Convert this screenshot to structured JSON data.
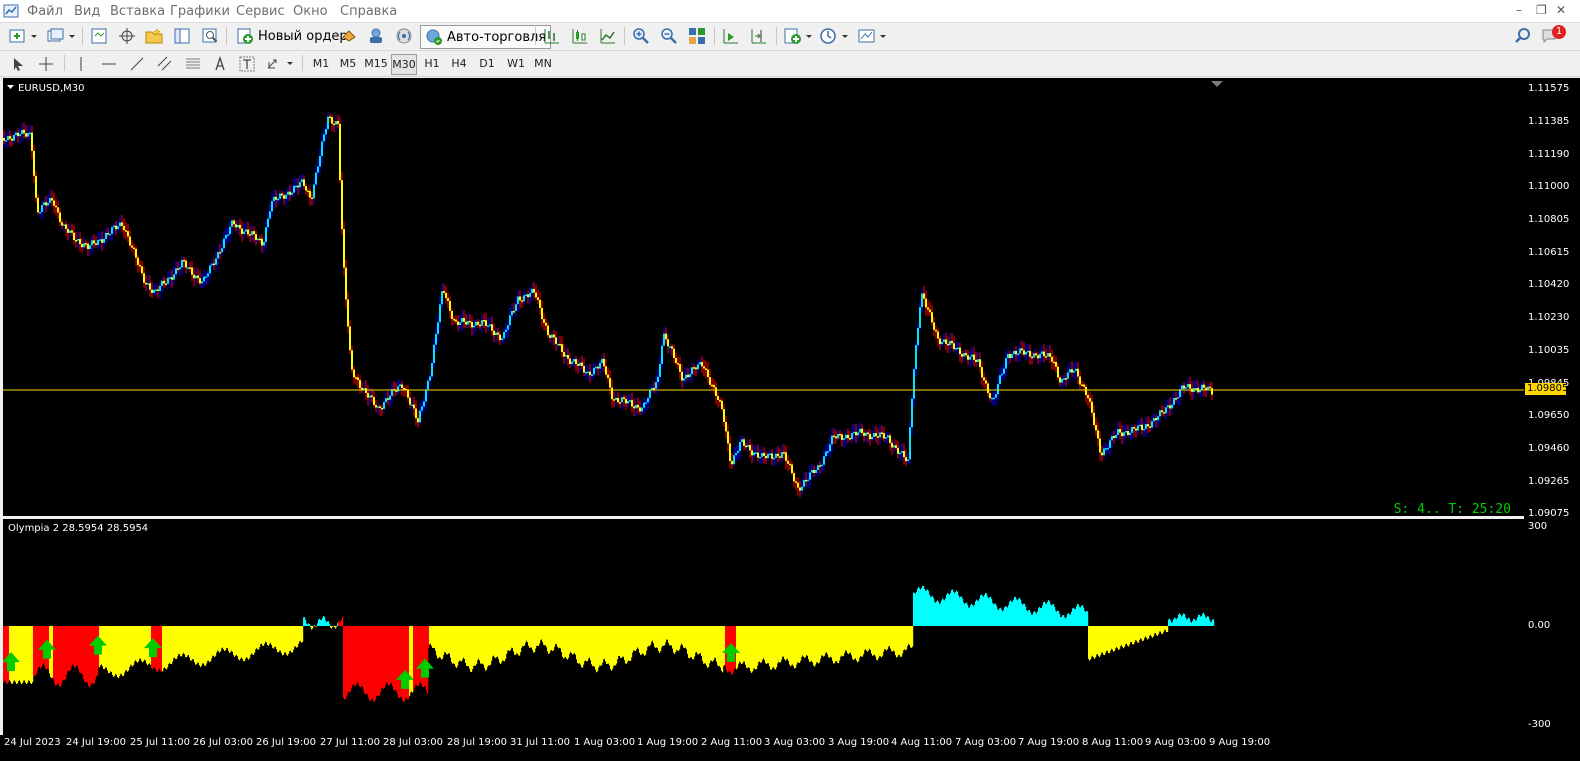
{
  "menu": [
    "Файл",
    "Вид",
    "Вставка",
    "Графики",
    "Сервис",
    "Окно",
    "Справка"
  ],
  "toolbar": {
    "new_order_label": "Новый ордер",
    "autotrade_label": "Авто-торговля",
    "notification_count": "1"
  },
  "timeframes": [
    "M1",
    "M5",
    "M15",
    "M30",
    "H1",
    "H4",
    "D1",
    "W1",
    "MN"
  ],
  "active_timeframe": "M30",
  "chart": {
    "symbol_label": "EURUSD,M30",
    "current_price": "1.09805",
    "price_ticks": [
      "1.11575",
      "1.11385",
      "1.11190",
      "1.11000",
      "1.10805",
      "1.10615",
      "1.10420",
      "1.10230",
      "1.10035",
      "1.09845",
      "1.09650",
      "1.09460",
      "1.09265",
      "1.09075"
    ],
    "status_text": "S: 4.. T: 25:20",
    "colors": {
      "up": "#00e5ff",
      "down": "#ffff00",
      "wick_up": "#0000ff",
      "wick_down": "#ff0000",
      "price_line": "#ffd700",
      "status": "#00cc00"
    }
  },
  "indicator": {
    "label": "Olympia 2 28.5954 28.5954",
    "scale_ticks": [
      "300",
      "0.00",
      "-300"
    ],
    "colors": {
      "bull": "#00ffff",
      "bear": "#ffff00",
      "signal_zone": "#ff0000",
      "arrow": "#00cc00"
    }
  },
  "time_labels": [
    "24 Jul 2023",
    "24 Jul 19:00",
    "25 Jul 11:00",
    "26 Jul 03:00",
    "26 Jul 19:00",
    "27 Jul 11:00",
    "28 Jul 03:00",
    "28 Jul 19:00",
    "31 Jul 11:00",
    "1 Aug 03:00",
    "1 Aug 19:00",
    "2 Aug 11:00",
    "3 Aug 03:00",
    "3 Aug 19:00",
    "4 Aug 11:00",
    "7 Aug 03:00",
    "7 Aug 19:00",
    "8 Aug 11:00",
    "9 Aug 03:00",
    "9 Aug 19:00"
  ]
}
